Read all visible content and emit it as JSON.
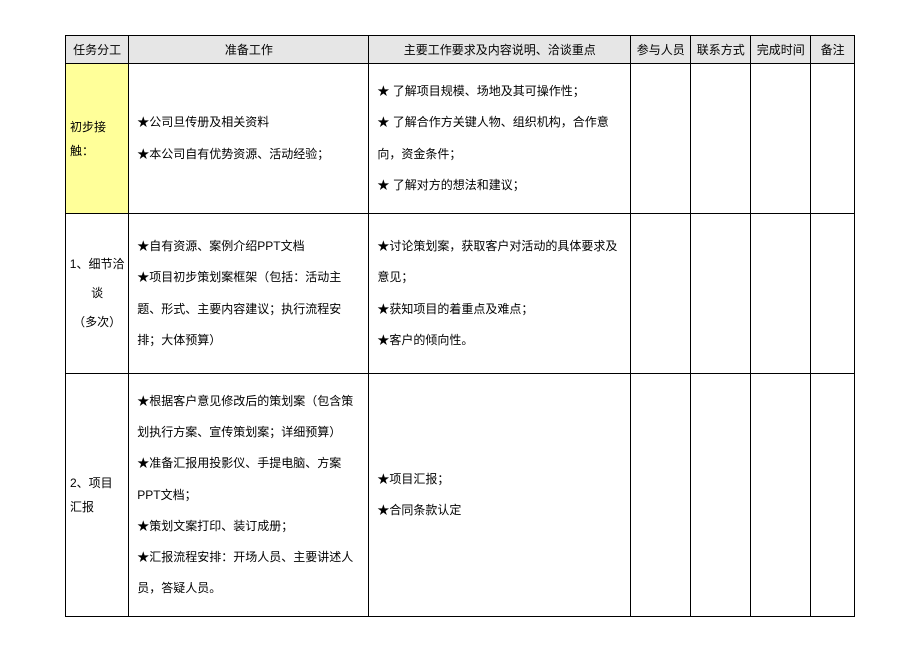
{
  "headers": {
    "task": "任务分工",
    "prep": "准备工作",
    "main": "主要工作要求及内容说明、洽谈重点",
    "people": "参与人员",
    "contact": "联系方式",
    "time": "完成时间",
    "note": "备注"
  },
  "rows": [
    {
      "task": "初步接触：",
      "highlight": true,
      "prep": "★公司旦传册及相关资料\n★本公司自有优势资源、活动经验；",
      "main": "★ 了解项目规模、场地及其可操作性；\n★ 了解合作方关键人物、组织机构，合作意向，资金条件；\n★ 了解对方的想法和建议；",
      "people": "",
      "contact": "",
      "time": "",
      "note": ""
    },
    {
      "task": "1、细节洽谈\n（多次）",
      "highlight": false,
      "prep": "★自有资源、案例介绍PPT文档\n★项目初步策划案框架（包括：活动主题、形式、主要内容建议；执行流程安排；大体预算）",
      "main": "★讨论策划案，获取客户对活动的具体要求及意见；\n★获知项目的着重点及难点；\n★客户的倾向性。",
      "people": "",
      "contact": "",
      "time": "",
      "note": ""
    },
    {
      "task": "2、项目汇报",
      "highlight": false,
      "prep": "★根据客户意见修改后的策划案（包含策划执行方案、宣传策划案；详细预算）\n★准备汇报用投影仪、手提电脑、方案PPT文档；\n★策划文案打印、装订成册；\n★汇报流程安排：开场人员、主要讲述人员，答疑人员。",
      "main": "★项目汇报；\n★合同条款认定",
      "people": "",
      "contact": "",
      "time": "",
      "note": ""
    }
  ]
}
